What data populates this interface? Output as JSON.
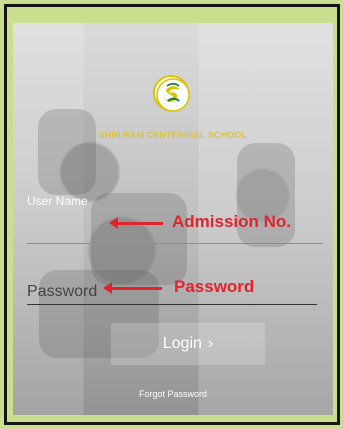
{
  "school": {
    "name": "SHRI RAM CENTENNIAL SCHOOL",
    "logo_text": "SHRI RAM CENTENNIAL SCHOOL"
  },
  "form": {
    "username_label": "User Name",
    "username_value": "",
    "password_placeholder": "Password",
    "password_value": "",
    "login_label": "Login",
    "login_icon": "chevron-right-icon",
    "forgot_label": "Forgot Password"
  },
  "annotations": {
    "admission_no": "Admission No.",
    "password": "Password",
    "arrow_color": "#e1252e"
  },
  "colors": {
    "frame_bg": "#c9df8f",
    "username_underline": "#3fb2a4",
    "logo_yellow": "#d9c400"
  }
}
